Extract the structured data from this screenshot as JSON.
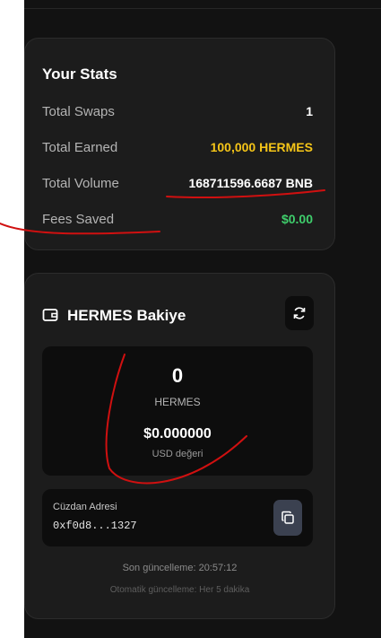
{
  "stats": {
    "title": "Your Stats",
    "rows": [
      {
        "label": "Total Swaps",
        "value": "1"
      },
      {
        "label": "Total Earned",
        "value": "100,000 HERMES"
      },
      {
        "label": "Total Volume",
        "value": "168711596.6687 BNB"
      },
      {
        "label": "Fees Saved",
        "value": "$0.00"
      }
    ]
  },
  "balance": {
    "title": "HERMES Bakiye",
    "amount": "0",
    "token": "HERMES",
    "usd_value": "$0.000000",
    "usd_label": "USD değeri",
    "wallet_label": "Cüzdan Adresi",
    "wallet_address": "0xf0d8...1327",
    "last_updated": "Son güncelleme: 20:57:12",
    "auto_update": "Otomatik güncelleme: Her 5 dakika"
  },
  "icons": {
    "wallet": "wallet-icon",
    "refresh": "refresh-icon",
    "copy": "copy-icon"
  },
  "colors": {
    "background": "#121212",
    "card": "#1c1c1c",
    "earned": "#f5c518",
    "saved": "#3fcf6c",
    "annotation": "#d01010"
  }
}
